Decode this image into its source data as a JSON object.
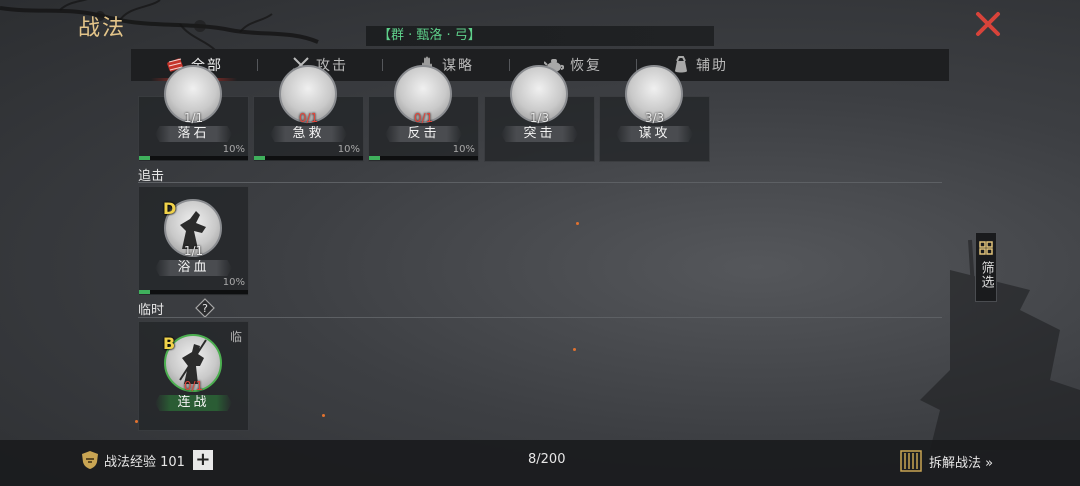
{
  "header": {
    "title": "战法",
    "banner": "【群 · 甄洛 · 弓】"
  },
  "tabs": [
    {
      "label": "全部",
      "icon": "scroll-icon",
      "active": true
    },
    {
      "label": "攻击",
      "icon": "crossed-swords-icon",
      "active": false
    },
    {
      "label": "谋略",
      "icon": "hand-icon",
      "active": false
    },
    {
      "label": "恢复",
      "icon": "teapot-icon",
      "active": false
    },
    {
      "label": "辅助",
      "icon": "pouch-icon",
      "active": false
    }
  ],
  "top_row": [
    {
      "name": "落石",
      "count": "1/1",
      "count_red": false,
      "pct": "10%",
      "progress": 0.1
    },
    {
      "name": "急救",
      "count": "0/1",
      "count_red": true,
      "pct": "10%",
      "progress": 0.1
    },
    {
      "name": "反击",
      "count": "0/1",
      "count_red": true,
      "pct": "10%",
      "progress": 0.1
    },
    {
      "name": "突击",
      "count": "1/3",
      "count_red": false
    },
    {
      "name": "谋攻",
      "count": "3/3",
      "count_red": false
    }
  ],
  "sections": {
    "pursuit": {
      "label": "追击",
      "cards": [
        {
          "grade": "D",
          "name": "浴血",
          "count": "1/1",
          "count_red": false,
          "pct": "10%",
          "progress": 0.1
        }
      ]
    },
    "temporary": {
      "label": "临时",
      "cards": [
        {
          "grade": "B",
          "name": "连战",
          "count": "0/1",
          "count_red": true,
          "tag": "临"
        }
      ]
    }
  },
  "filter": {
    "label": "筛选"
  },
  "footer": {
    "exp_label": "战法经验 101",
    "plus": "+",
    "capacity": "8/200",
    "disassemble": "拆解战法 »"
  },
  "colors": {
    "accent_gold": "#e4c58a",
    "banner_green": "#5fd08b",
    "close_red": "#d8433a",
    "progress_green": "#3fb05c",
    "count_red": "#e0463c"
  }
}
